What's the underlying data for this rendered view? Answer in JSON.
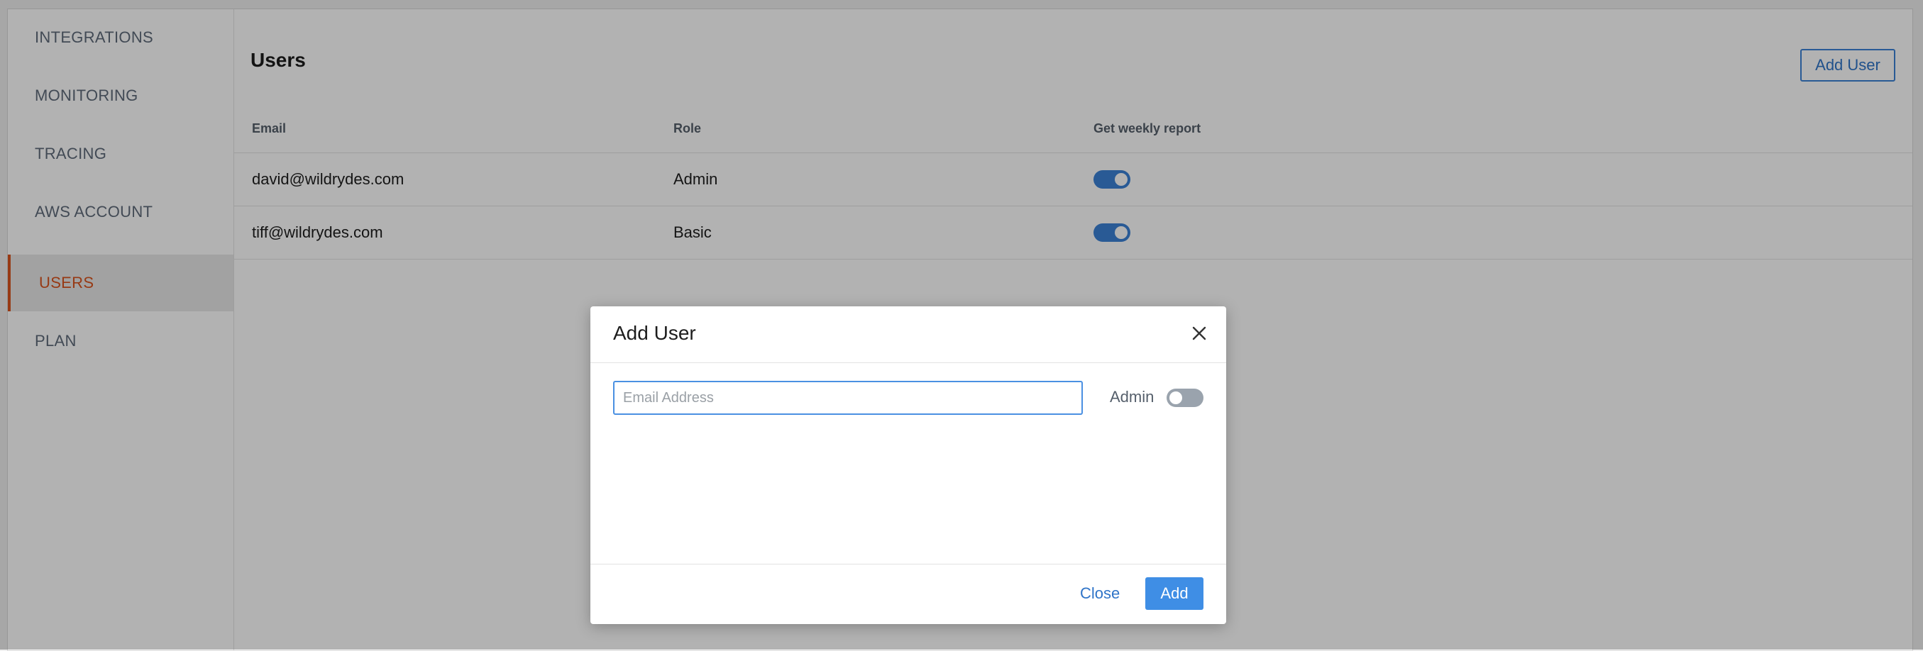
{
  "sidebar": {
    "items": [
      {
        "label": "INTEGRATIONS"
      },
      {
        "label": "MONITORING"
      },
      {
        "label": "TRACING"
      },
      {
        "label": "AWS ACCOUNT"
      },
      {
        "label": "USERS",
        "active": true
      },
      {
        "label": "PLAN"
      }
    ]
  },
  "main": {
    "title": "Users",
    "add_user_label": "Add User",
    "table": {
      "headers": [
        "Email",
        "Role",
        "Get weekly report"
      ],
      "rows": [
        {
          "email": "david@wildrydes.com",
          "role": "Admin",
          "weekly_report": true
        },
        {
          "email": "tiff@wildrydes.com",
          "role": "Basic",
          "weekly_report": true
        }
      ]
    }
  },
  "modal": {
    "title": "Add User",
    "email_value": "",
    "email_placeholder": "Email Address",
    "admin_label": "Admin",
    "admin_enabled": false,
    "close_label": "Close",
    "add_label": "Add"
  },
  "icons": {
    "modal_close": "close-icon"
  },
  "colors": {
    "accent": "#3b82d6",
    "active_nav": "#d9531e"
  }
}
